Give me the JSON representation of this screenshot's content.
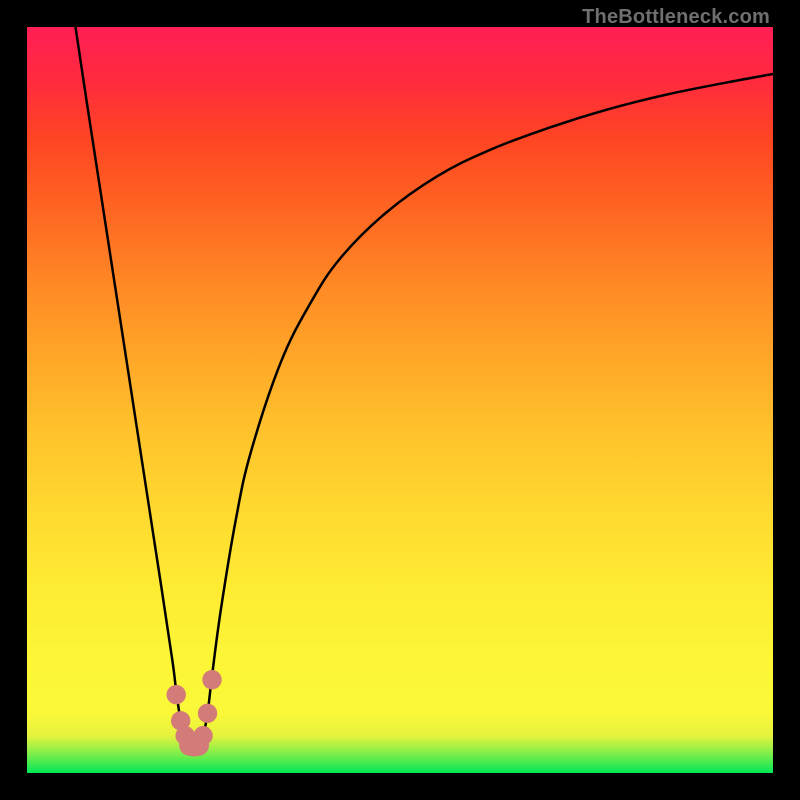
{
  "attribution": "TheBottleneck.com",
  "colors": {
    "marker": "#d37b78",
    "curve": "#000000",
    "frame": "#000000"
  },
  "chart_data": {
    "type": "line",
    "title": "",
    "xlabel": "",
    "ylabel": "",
    "xlim": [
      0,
      100
    ],
    "ylim": [
      0,
      100
    ],
    "series": [
      {
        "name": "left-branch",
        "x": [
          6.5,
          8,
          10,
          12,
          14,
          16,
          18,
          19.5,
          20,
          20.6,
          21.2,
          21.8,
          22.4
        ],
        "y": [
          100,
          90,
          77,
          64,
          51,
          38,
          25,
          15,
          11,
          7,
          5,
          3.7,
          3.6
        ]
      },
      {
        "name": "right-branch",
        "x": [
          22.4,
          23.0,
          23.6,
          24.2,
          24.8,
          26,
          28,
          30,
          34,
          38,
          42,
          48,
          55,
          62,
          70,
          78,
          86,
          94,
          100
        ],
        "y": [
          3.6,
          3.7,
          5,
          8,
          13,
          22,
          34,
          43,
          55,
          63,
          69,
          75,
          80,
          83.5,
          86.5,
          89,
          91,
          92.6,
          93.7
        ]
      }
    ],
    "markers": {
      "name": "bottom-cluster",
      "points": [
        {
          "x": 20.0,
          "y": 10.5,
          "r": 1.3
        },
        {
          "x": 20.6,
          "y": 7.0,
          "r": 1.3
        },
        {
          "x": 21.2,
          "y": 5.0,
          "r": 1.3
        },
        {
          "x": 21.8,
          "y": 3.7,
          "r": 1.4
        },
        {
          "x": 22.4,
          "y": 3.6,
          "r": 1.4
        },
        {
          "x": 23.0,
          "y": 3.7,
          "r": 1.4
        },
        {
          "x": 23.6,
          "y": 5.0,
          "r": 1.3
        },
        {
          "x": 24.2,
          "y": 8.0,
          "r": 1.3
        },
        {
          "x": 24.8,
          "y": 12.5,
          "r": 1.3
        }
      ]
    }
  }
}
